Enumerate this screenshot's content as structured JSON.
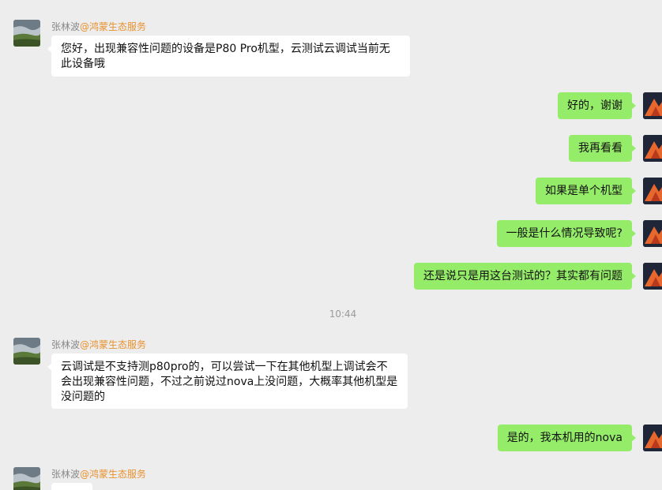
{
  "contact": {
    "name": "张林波",
    "org": "@鸿蒙生态服务"
  },
  "messages": [
    {
      "side": "left",
      "text": "您好，出现兼容性问题的设备是P80 Pro机型，云测试云调试当前无此设备哦"
    },
    {
      "side": "right",
      "text": "好的，谢谢"
    },
    {
      "side": "right",
      "text": "我再看看"
    },
    {
      "side": "right",
      "text": "如果是单个机型"
    },
    {
      "side": "right",
      "text": "一般是什么情况导致呢?"
    },
    {
      "side": "right",
      "text": "还是说只是用这台测试的？其实都有问题"
    },
    {
      "side": "left",
      "text": "云调试是不支持测p80pro的，可以尝试一下在其他机型上调试会不会出现兼容性问题，不过之前说过nova上没问题，大概率其他机型是没问题的"
    },
    {
      "side": "right",
      "text": "是的，我本机用的nova"
    },
    {
      "side": "left",
      "text": ""
    }
  ],
  "timestamp": "10:44",
  "colors": {
    "background": "#ededed",
    "self_bubble": "#95ec69",
    "other_bubble": "#ffffff",
    "org_accent": "#e8912e"
  }
}
